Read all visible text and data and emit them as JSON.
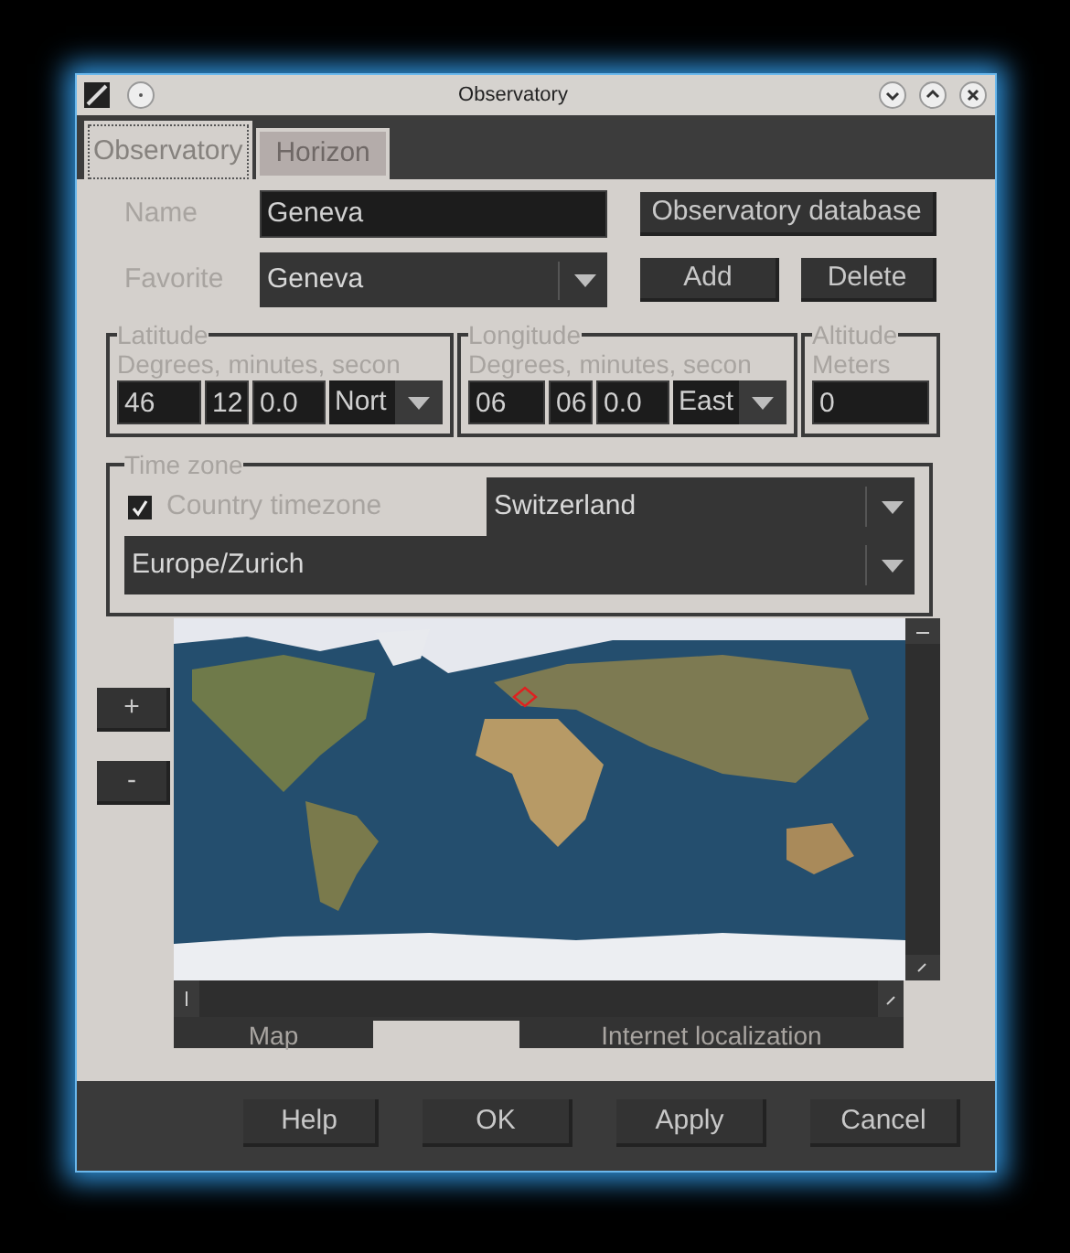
{
  "window": {
    "title": "Observatory"
  },
  "tabs": [
    {
      "label": "Observatory",
      "selected": true
    },
    {
      "label": "Horizon",
      "selected": false
    }
  ],
  "name": {
    "label": "Name",
    "value": "Geneva"
  },
  "favorite": {
    "label": "Favorite",
    "value": "Geneva"
  },
  "database_button": "Observatory database",
  "favorite_buttons": [
    "Add",
    "Delete"
  ],
  "latitude": {
    "title": "Latitude",
    "hint": "Degrees, minutes, secon",
    "degrees": "46",
    "minutes": "12",
    "seconds": "0.0",
    "direction": "Nort"
  },
  "longitude": {
    "title": "Longitude",
    "hint": "Degrees, minutes, secon",
    "degrees": "06",
    "minutes": "06",
    "seconds": "0.0",
    "direction": "East"
  },
  "altitude": {
    "title": "Altitude",
    "hint": "Meters",
    "value": "0"
  },
  "time_zone": {
    "title": "Time zone",
    "country_timezone": {
      "label": "Country timezone",
      "checked": true
    },
    "country": "Switzerland",
    "zone": "Europe/Zurich"
  },
  "zoom_buttons": [
    "+",
    "-"
  ],
  "map_tabs": [
    {
      "label": "Map",
      "selected": false
    },
    {
      "label": "Internet localization",
      "selected": false
    }
  ],
  "dialog_buttons": [
    "Help",
    "OK",
    "Apply",
    "Cancel"
  ]
}
